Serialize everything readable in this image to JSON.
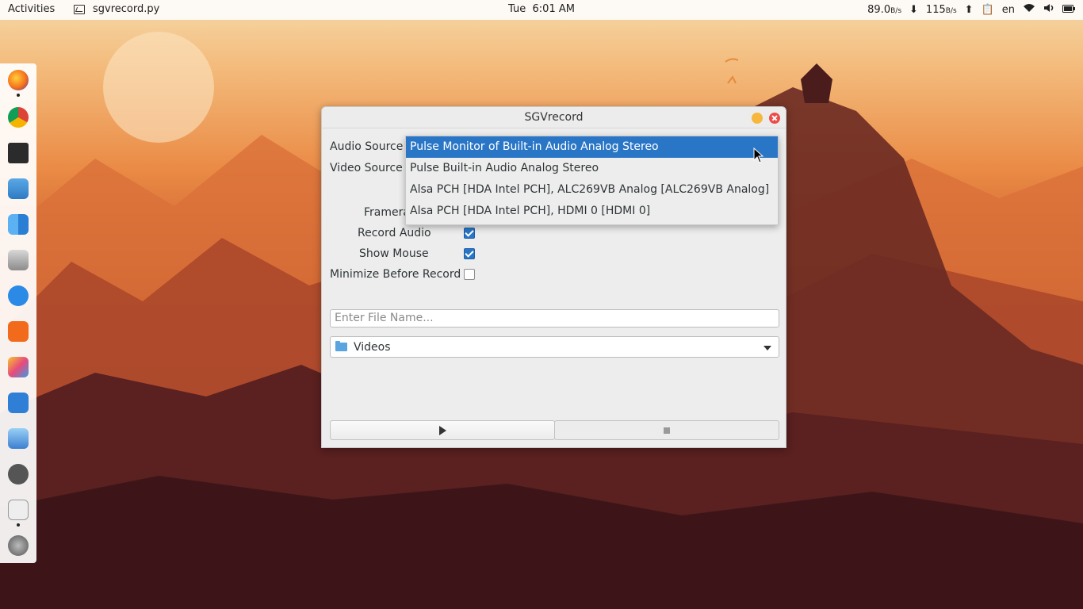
{
  "topbar": {
    "activities": "Activities",
    "app_name": "sgvrecord.py",
    "day": "Tue",
    "time": "6:01 AM",
    "download_speed": "89.0",
    "download_unit": "B/s",
    "upload_speed": "115",
    "upload_unit": "B/s",
    "language": "en"
  },
  "dock": {
    "items": [
      "firefox-icon",
      "chrome-icon",
      "terminal-icon",
      "map-icon",
      "finder-icon",
      "disk-icon",
      "app-store-icon",
      "audacity-icon",
      "paint-icon",
      "network-icon",
      "files-icon",
      "settings-icon",
      "empty-icon",
      "launchpad-icon"
    ]
  },
  "window": {
    "title": "SGVrecord",
    "audio_source_label": "Audio Source",
    "video_source_label": "Video Source",
    "framerate_label": "Framera",
    "record_audio_label": "Record Audio",
    "record_audio_checked": true,
    "show_mouse_label": "Show Mouse",
    "show_mouse_checked": true,
    "minimize_label": "Minimize Before Record",
    "minimize_checked": false,
    "filename_placeholder": "Enter File Name...",
    "folder": "Videos"
  },
  "audio_dropdown": {
    "options": [
      "Pulse Monitor of Built-in Audio Analog Stereo",
      "Pulse Built-in Audio Analog Stereo",
      "Alsa PCH [HDA Intel PCH], ALC269VB Analog [ALC269VB Analog]",
      "Alsa PCH [HDA Intel PCH], HDMI 0 [HDMI 0]"
    ],
    "selected_index": 0
  },
  "colors": {
    "accent": "#2a76c6",
    "close": "#ed4b4b",
    "minimize": "#f6b73c"
  }
}
